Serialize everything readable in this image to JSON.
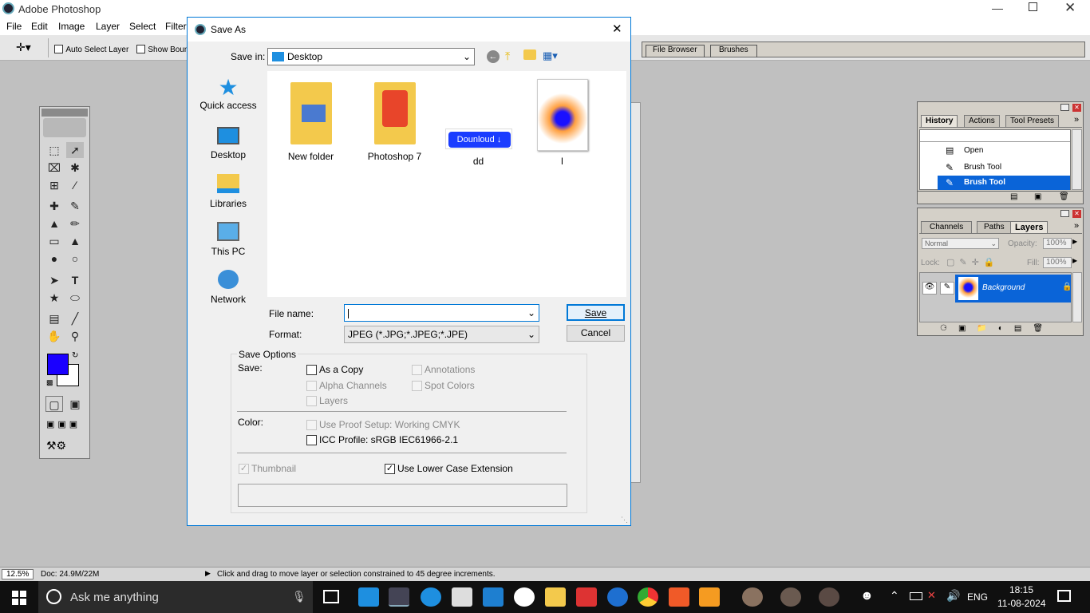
{
  "app": {
    "title": "Adobe Photoshop"
  },
  "menu": [
    "File",
    "Edit",
    "Image",
    "Layer",
    "Select",
    "Filter"
  ],
  "options_bar": {
    "auto_select": "Auto Select Layer",
    "show_bounds": "Show Bounding",
    "palette_tabs": [
      "File Browser",
      "Brushes"
    ]
  },
  "history_panel": {
    "tabs": [
      "History",
      "Actions",
      "Tool Presets"
    ],
    "items": [
      "Open",
      "Brush Tool",
      "Brush Tool"
    ]
  },
  "layers_panel": {
    "tabs": [
      "Channels",
      "Paths",
      "Layers"
    ],
    "blend_mode": "Normal",
    "opacity_label": "Opacity:",
    "opacity": "100%",
    "lock_label": "Lock:",
    "fill_label": "Fill:",
    "fill": "100%",
    "layer_name": "Background"
  },
  "dialog": {
    "title": "Save As",
    "save_in_label": "Save in:",
    "save_in_value": "Desktop",
    "places": [
      "Quick access",
      "Desktop",
      "Libraries",
      "This PC",
      "Network"
    ],
    "files": [
      {
        "name": "New folder",
        "icon": "folder-icon"
      },
      {
        "name": "Photoshop 7",
        "icon": "brave-folder-icon"
      },
      {
        "name": "dd",
        "icon": "download-button-image",
        "badge": "Dounloud"
      },
      {
        "name": "l",
        "icon": "image-thumbnail"
      }
    ],
    "file_name_label": "File name:",
    "file_name_value": "",
    "format_label": "Format:",
    "format_value": "JPEG (*.JPG;*.JPEG;*.JPE)",
    "save_button": "Save",
    "cancel_button": "Cancel",
    "save_options": {
      "title": "Save Options",
      "save_label": "Save:",
      "as_a_copy": "As a Copy",
      "annotations": "Annotations",
      "alpha_channels": "Alpha Channels",
      "spot_colors": "Spot Colors",
      "layers": "Layers",
      "color_label": "Color:",
      "use_proof_setup": "Use Proof Setup:  Working CMYK",
      "icc_profile": "ICC Profile:  sRGB IEC61966-2.1",
      "thumbnail": "Thumbnail",
      "lower_case_ext": "Use Lower Case Extension"
    }
  },
  "status_bar": {
    "zoom": "12.5%",
    "doc": "Doc: 24.9M/22M",
    "hint": "Click and drag to move layer or selection constrained to 45 degree increments."
  },
  "taskbar": {
    "search_placeholder": "Ask me anything",
    "language": "ENG",
    "time": "18:15",
    "date": "11-08-2024"
  },
  "colors": {
    "foreground": "#1a00ff",
    "selection": "#0a64d8",
    "dialog_border": "#0078d7"
  }
}
